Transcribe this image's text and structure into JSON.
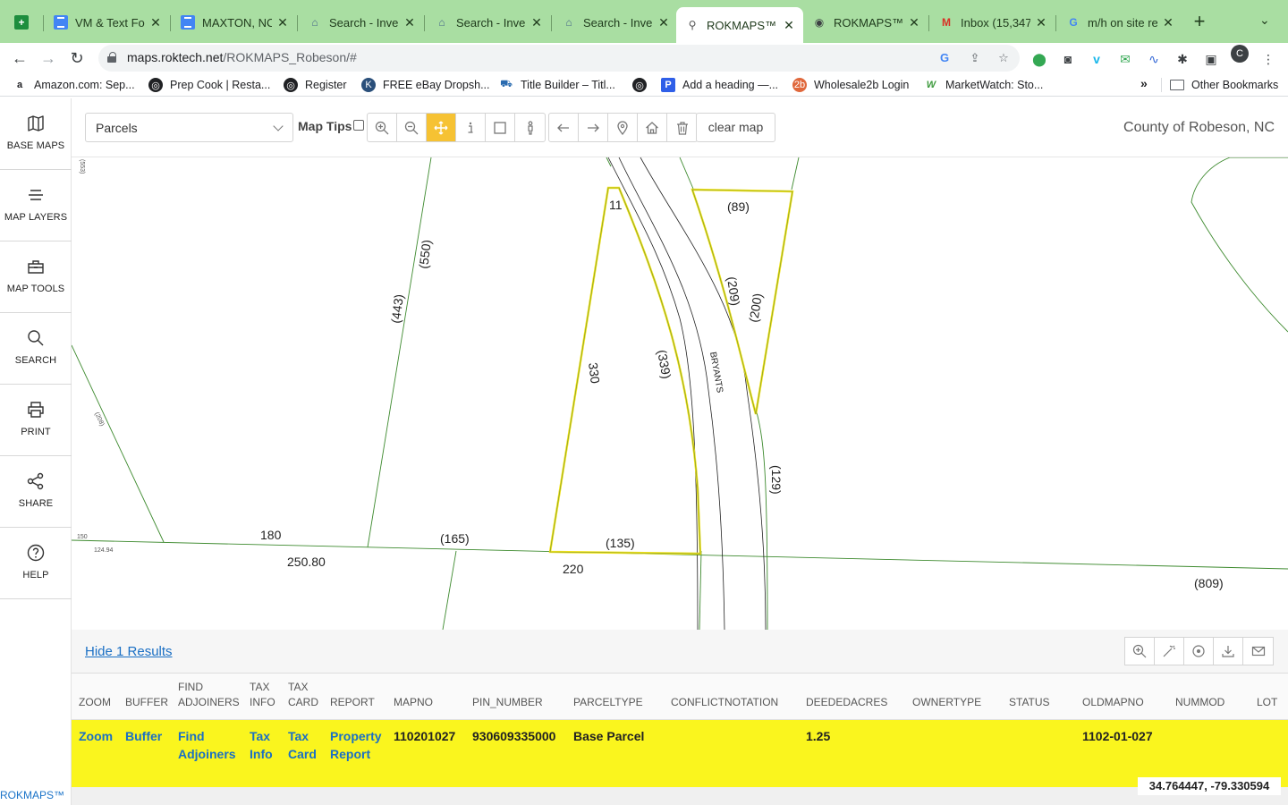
{
  "browser": {
    "tabs": [
      {
        "label": "",
        "icon": "sheets-icon"
      },
      {
        "label": "VM & Text Fo",
        "icon": "docs-icon"
      },
      {
        "label": "MAXTON, NC",
        "icon": "docs-icon"
      },
      {
        "label": "Search - Inve",
        "icon": "house-icon"
      },
      {
        "label": "Search - Inve",
        "icon": "house-icon"
      },
      {
        "label": "Search - Inve",
        "icon": "house-icon"
      },
      {
        "label": "ROKMAPS™",
        "icon": "rokmaps-icon",
        "active": true
      },
      {
        "label": "ROKMAPS™",
        "icon": "globe-icon"
      },
      {
        "label": "Inbox (15,347",
        "icon": "gmail-icon"
      },
      {
        "label": "m/h on site re",
        "icon": "google-icon"
      }
    ],
    "url_host": "maps.roktech.net",
    "url_path": "/ROKMAPS_Robeson/#",
    "profile_initial": "C",
    "tab_bar_color": "#a9dea2"
  },
  "bookmarks": {
    "items": [
      {
        "label": "Amazon.com: Sep...",
        "icon": "amazon-icon"
      },
      {
        "label": "Prep Cook | Resta...",
        "icon": "globe-icon"
      },
      {
        "label": "Register",
        "icon": "globe-icon"
      },
      {
        "label": "FREE eBay Dropsh...",
        "icon": "kf-icon"
      },
      {
        "label": "Title Builder – Titl...",
        "icon": "car-icon"
      },
      {
        "label": "",
        "icon": "globe-icon"
      },
      {
        "label": "Add a heading —...",
        "icon": "p-icon"
      },
      {
        "label": "Wholesale2b Login",
        "icon": "wholesale2b-icon"
      },
      {
        "label": "MarketWatch: Sto...",
        "icon": "marketwatch-icon"
      }
    ],
    "more": "»",
    "other": "Other Bookmarks"
  },
  "sidebar": {
    "items": [
      {
        "label": "BASE MAPS",
        "icon": "map-icon"
      },
      {
        "label": "MAP LAYERS",
        "icon": "layers-icon"
      },
      {
        "label": "MAP TOOLS",
        "icon": "toolbox-icon"
      },
      {
        "label": "SEARCH",
        "icon": "search-icon"
      },
      {
        "label": "PRINT",
        "icon": "printer-icon"
      },
      {
        "label": "SHARE",
        "icon": "share-icon"
      },
      {
        "label": "HELP",
        "icon": "help-icon"
      }
    ],
    "brand": "ROKMAPS™"
  },
  "header": {
    "layer_value": "Parcels",
    "map_tips_label": "Map Tips",
    "clear_map": "clear map",
    "county": "County of Robeson, NC",
    "accent": "#f6c233"
  },
  "map": {
    "labels": {
      "l11": "11",
      "l89": "(89)",
      "l550": "(550)",
      "l443": "(443)",
      "l209": "(209)",
      "l200": "(200)",
      "l330": "330",
      "l339": "(339)",
      "road": "BRYANTS",
      "l129": "(129)",
      "l180": "180",
      "l250": "250.80",
      "l165": "(165)",
      "l135": "(135)",
      "l220": "220",
      "l809": "(809)",
      "l150": "150",
      "l124": "124.94",
      "l208": "(208)",
      "l553": "(553)"
    },
    "selection_color": "#f2e21a",
    "line_color": "#3d8a2e"
  },
  "results": {
    "toggle": "Hide 1 Results",
    "columns": [
      "ZOOM",
      "BUFFER",
      "FIND ADJOINERS",
      "TAX INFO",
      "TAX CARD",
      "REPORT",
      "MAPNO",
      "PIN_NUMBER",
      "PARCELTYPE",
      "CONFLICTNOTATION",
      "DEEDEDACRES",
      "OWNERTYPE",
      "STATUS",
      "OLDMAPNO",
      "NUMMOD",
      "LOT"
    ],
    "row": {
      "zoom": "Zoom",
      "buffer": "Buffer",
      "find_adjoiners": "Find Adjoiners",
      "tax_info": "Tax Info",
      "tax_card": "Tax Card",
      "report": "Property Report",
      "mapno": "110201027",
      "pin_number": "930609335000",
      "parceltype": "Base Parcel",
      "conflictnotation": "",
      "dededacres": "1.25",
      "ownertype": "",
      "status": "",
      "oldmapno": "1102-01-027",
      "nummod": "",
      "lot": ""
    },
    "coordinates": "34.764447, -79.330594"
  }
}
